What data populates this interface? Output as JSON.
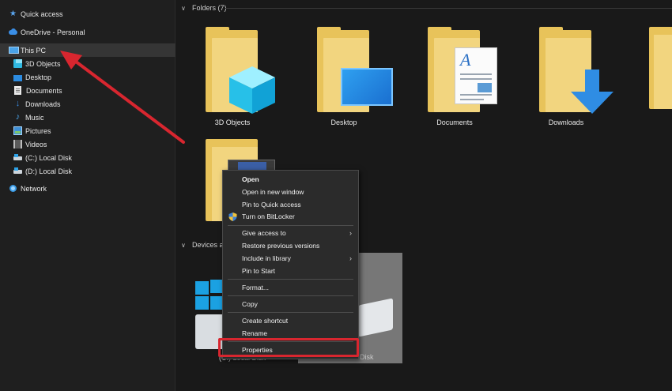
{
  "sidebar": {
    "items": [
      {
        "label": "Quick access",
        "icon": "star-icon"
      },
      {
        "label": "OneDrive - Personal",
        "icon": "cloud-icon"
      },
      {
        "label": "This PC",
        "icon": "computer-icon",
        "selected": true
      },
      {
        "label": "3D Objects",
        "icon": "cube-icon"
      },
      {
        "label": "Desktop",
        "icon": "desktop-icon"
      },
      {
        "label": "Documents",
        "icon": "document-icon"
      },
      {
        "label": "Downloads",
        "icon": "download-icon"
      },
      {
        "label": "Music",
        "icon": "music-icon"
      },
      {
        "label": "Pictures",
        "icon": "pictures-icon"
      },
      {
        "label": "Videos",
        "icon": "videos-icon"
      },
      {
        "label": "(C:) Local Disk",
        "icon": "drive-icon"
      },
      {
        "label": "(D:) Local Disk",
        "icon": "drive-icon"
      },
      {
        "label": "Network",
        "icon": "network-icon"
      }
    ]
  },
  "main": {
    "folders_header": "Folders (7)",
    "devices_header": "Devices and",
    "folders": [
      {
        "label": "3D Objects"
      },
      {
        "label": "Desktop"
      },
      {
        "label": "Documents"
      },
      {
        "label": "Downloads"
      }
    ],
    "drives": [
      {
        "label": "(C:) Local Disk"
      },
      {
        "label": "(D:) Local Disk"
      }
    ],
    "drive_c_visible_label": "(C:) Local Disk",
    "drive_d_visible_label": "Disk"
  },
  "context_menu": {
    "items": [
      {
        "label": "Open",
        "bold": true
      },
      {
        "label": "Open in new window"
      },
      {
        "label": "Pin to Quick access"
      },
      {
        "label": "Turn on BitLocker",
        "icon": "shield-icon"
      },
      {
        "label": "Give access to",
        "submenu": true
      },
      {
        "label": "Restore previous versions"
      },
      {
        "label": "Include in library",
        "submenu": true
      },
      {
        "label": "Pin to Start"
      },
      {
        "label": "Format..."
      },
      {
        "label": "Copy"
      },
      {
        "label": "Create shortcut"
      },
      {
        "label": "Rename"
      },
      {
        "label": "Properties",
        "highlighted": true
      }
    ],
    "submenu_glyph": "›"
  },
  "colors": {
    "annotation_red": "#d8262f",
    "accent_blue": "#2f8de4",
    "folder_yellow": "#f2d57f"
  }
}
